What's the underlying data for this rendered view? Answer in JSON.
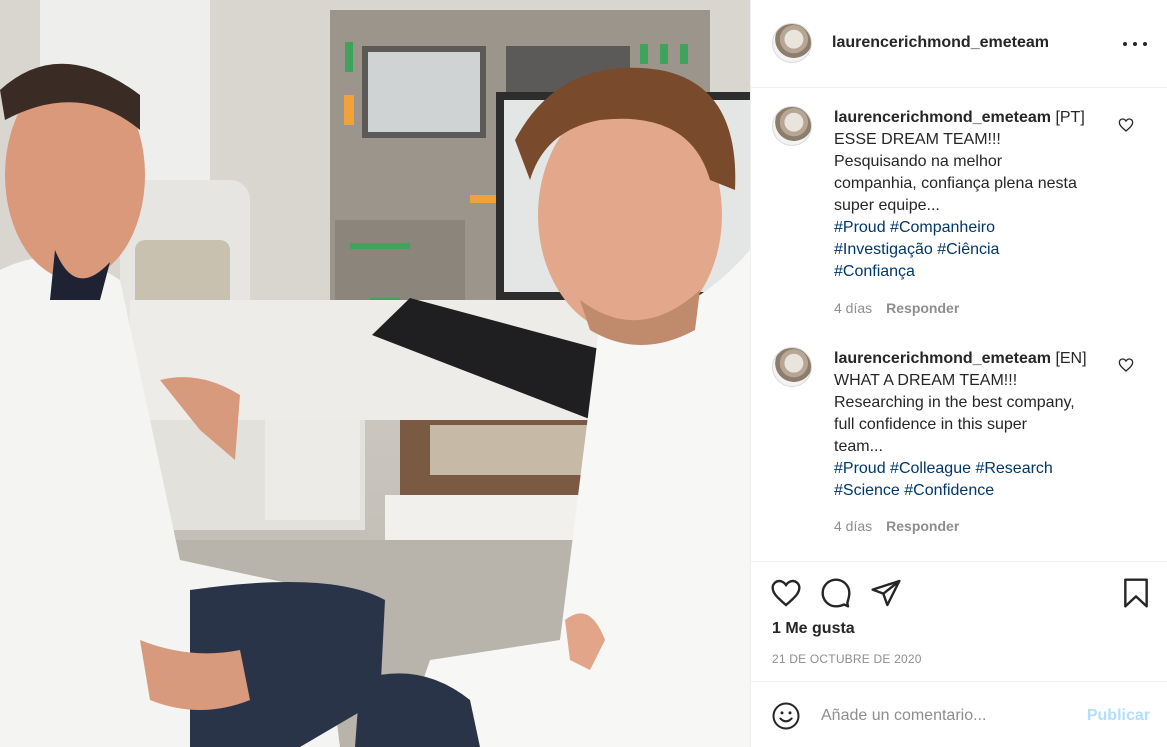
{
  "post": {
    "author": "laurencerichmond_emeteam",
    "more_icon": "more-horizontal-icon"
  },
  "comments": [
    {
      "username": "laurencerichmond_emeteam",
      "text_lines": [
        "[PT]",
        "ESSE DREAM TEAM!!!",
        "Pesquisando na melhor",
        "companhia, confiança plena nesta",
        "super equipe..."
      ],
      "hashtag_lines": [
        [
          "#Proud",
          "#Companheiro"
        ],
        [
          "#Investigação",
          "#Ciência"
        ],
        [
          "#Confiança"
        ]
      ],
      "time": "4 días",
      "reply_label": "Responder"
    },
    {
      "username": "laurencerichmond_emeteam",
      "text_lines": [
        "[EN]",
        "WHAT A DREAM TEAM!!!",
        "Researching in the best company,",
        "full confidence in this super",
        "team..."
      ],
      "hashtag_lines": [
        [
          "#Proud",
          "#Colleague",
          "#Research"
        ],
        [
          "#Science",
          "#Confidence"
        ]
      ],
      "time": "4 días",
      "reply_label": "Responder"
    }
  ],
  "actions": {
    "like_icon": "heart-icon",
    "comment_icon": "comment-bubble-icon",
    "share_icon": "paper-plane-icon",
    "save_icon": "bookmark-icon",
    "likes_text": "1 Me gusta",
    "date_text": "21 DE OCTUBRE DE 2020"
  },
  "add_comment": {
    "emoji_icon": "smiley-icon",
    "placeholder": "Añade un comentario...",
    "publish_label": "Publicar"
  },
  "colors": {
    "hashtag": "#00376b",
    "publish_disabled": "#b2dffc",
    "muted_text": "#8e8e8e"
  }
}
